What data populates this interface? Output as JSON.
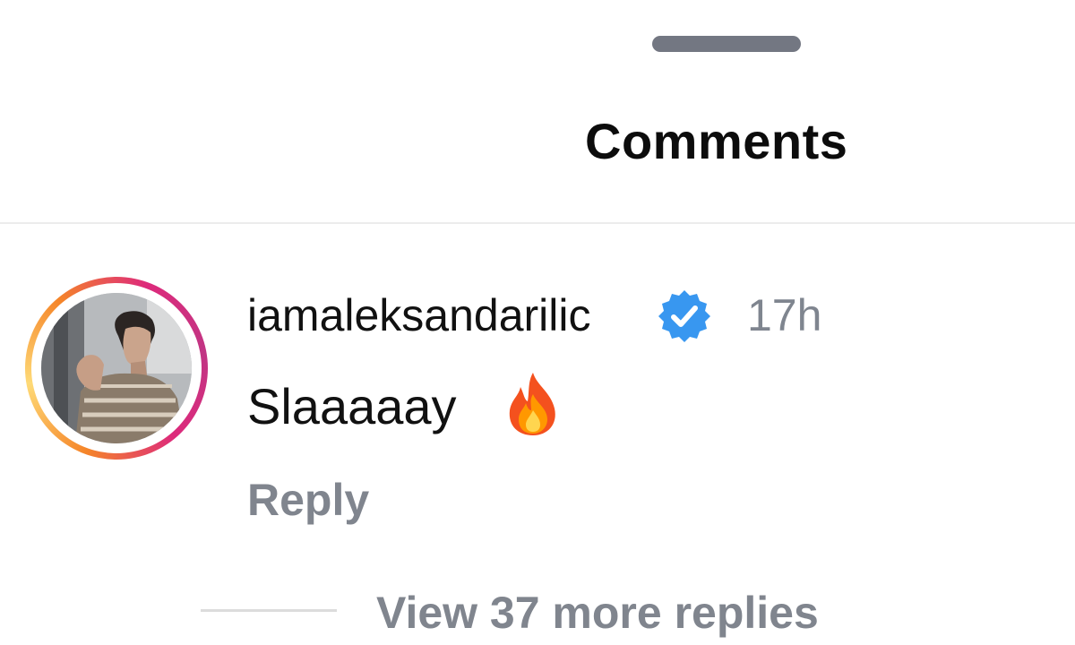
{
  "sheet": {
    "title": "Comments"
  },
  "comment": {
    "username": "iamaleksandarilic",
    "verified": true,
    "timestamp": "17h",
    "text": "Slaaaaay",
    "emoji_icon": "fire-icon",
    "reply_label": "Reply",
    "view_replies_label": "View 37 more replies"
  },
  "colors": {
    "verified_badge": "#3897f0",
    "secondary_text": "#80858e",
    "primary_text": "#111111",
    "story_ring_start": "#f58529",
    "story_ring_end": "#c13584"
  }
}
